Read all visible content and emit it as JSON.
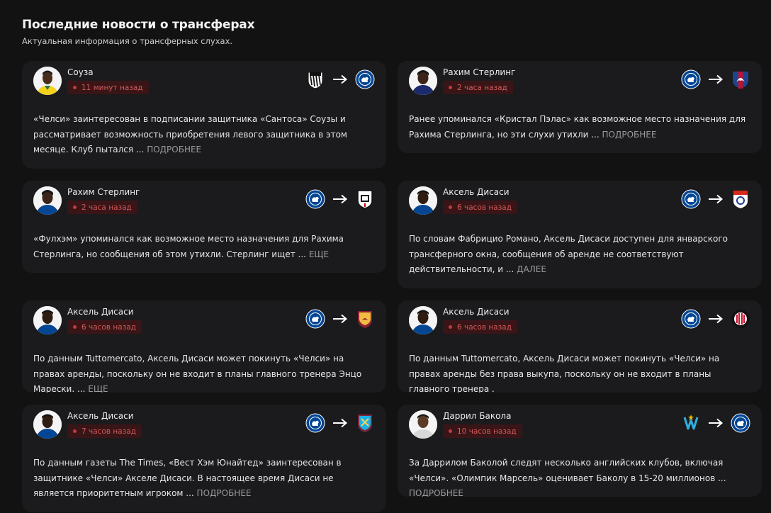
{
  "header": {
    "title": "Последние новости о трансферах",
    "subtitle": "Актуальная информация о трансферных слухах."
  },
  "cards": [
    {
      "name": "Соуза",
      "time": "11 минут назад",
      "from": "santos",
      "to": "chelsea",
      "text": "«Челси» заинтересован в подписании защитника «Сантоса» Соузы и рассматривает возможность приобретения левого защитника в этом месяце. Клуб пытался ...",
      "more": "ПОДРОБНЕЕ"
    },
    {
      "name": "Рахим Стерлинг",
      "time": "2 часа назад",
      "from": "chelsea",
      "to": "crystal-palace",
      "text": "Ранее упоминался «Кристал Пэлас» как возможное место назначения для Рахима Стерлинга, но эти слухи утихли ...",
      "more": "ПОДРОБНЕЕ"
    },
    {
      "name": "Рахим Стерлинг",
      "time": "2 часа назад",
      "from": "chelsea",
      "to": "fulham",
      "text": "«Фулхэм» упоминался как возможное место назначения для Рахима Стерлинга, но сообщения об этом утихли. Стерлинг ищет ...",
      "more": "ЕЩЕ"
    },
    {
      "name": "Аксель Дисаси",
      "time": "6 часов назад",
      "from": "chelsea",
      "to": "lyon",
      "text": "По словам Фабрицио Романо, Аксель Дисаси доступен для январского трансферного окна, сообщения об аренде не соответствуют действительности, и ...",
      "more": "ДАЛЕЕ"
    },
    {
      "name": "Аксель Дисаси",
      "time": "6 часов назад",
      "from": "chelsea",
      "to": "roma",
      "text": "По данным Tuttomercato, Аксель Дисаси может покинуть «Челси» на правах аренды, поскольку он не входит в планы главного тренера Энцо Марески. ...",
      "more": "ЕЩЕ"
    },
    {
      "name": "Аксель Дисаси",
      "time": "6 часов назад",
      "from": "chelsea",
      "to": "ac-milan",
      "text": "По данным Tuttomercato, Аксель Дисаси может покинуть «Челси» на правах аренды без права выкупа, поскольку он не входит в планы главного тренера .",
      "more": ""
    },
    {
      "name": "Аксель Дисаси",
      "time": "7 часов назад",
      "from": "chelsea",
      "to": "west-ham",
      "text": "По данным газеты The Times, «Вест Хэм Юнайтед» заинтересован в защитнике «Челси» Акселе Дисаси. В настоящее время Дисаси не является приоритетным игроком ...",
      "more": "ПОДРОБНЕЕ"
    },
    {
      "name": "Даррил Бакола",
      "time": "10 часов назад",
      "from": "marseille",
      "to": "chelsea",
      "text": "За Даррилом Баколой следят несколько английских клубов, включая «Челси». «Олимпик Марсель» оценивает Баколу в 15-20 миллионов ...",
      "more": "ПОДРОБНЕЕ"
    }
  ],
  "colors": {
    "accent_red": "#c43b3b",
    "chelsea_blue": "#034694"
  }
}
